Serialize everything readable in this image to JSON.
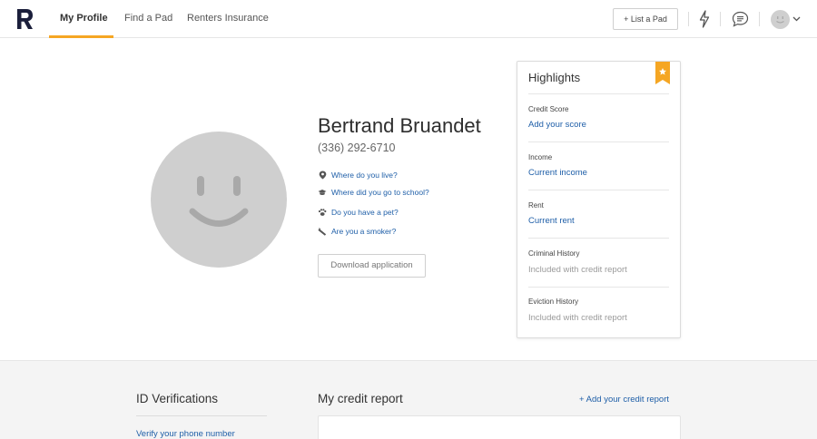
{
  "nav": {
    "links": [
      {
        "label": "My Profile",
        "active": true
      },
      {
        "label": "Find a Pad",
        "active": false
      },
      {
        "label": "Renters Insurance",
        "active": false
      }
    ],
    "list_button": "+ List a Pad",
    "icons": [
      "bolt-icon",
      "chat-icon",
      "user-avatar",
      "chevron-down-icon"
    ],
    "accent_color": "#f5a623"
  },
  "profile": {
    "name": "Bertrand Bruandet",
    "phone": "(336) 292-6710",
    "questions": [
      {
        "icon": "location-pin-icon",
        "label": "Where do you live?"
      },
      {
        "icon": "graduation-cap-icon",
        "label": "Where did you go to school?"
      },
      {
        "icon": "paw-icon",
        "label": "Do you have a pet?"
      },
      {
        "icon": "cigarette-icon",
        "label": "Are you a smoker?"
      }
    ],
    "download_button": "Download application"
  },
  "highlights": {
    "title": "Highlights",
    "items": [
      {
        "label": "Credit Score",
        "value": "Add your score",
        "muted": false
      },
      {
        "label": "Income",
        "value": "Current income",
        "muted": false
      },
      {
        "label": "Rent",
        "value": "Current rent",
        "muted": false
      },
      {
        "label": "Criminal History",
        "value": "Included with credit report",
        "muted": true
      },
      {
        "label": "Eviction History",
        "value": "Included with credit report",
        "muted": true
      }
    ]
  },
  "id_verifications": {
    "title": "ID Verifications",
    "link": "Verify your phone number"
  },
  "credit_report": {
    "title": "My credit report",
    "add_link": "+ Add your credit report"
  },
  "colors": {
    "link": "#1f5fa8",
    "ribbon": "#f5a623",
    "avatar_bg": "#cfcfcf"
  }
}
